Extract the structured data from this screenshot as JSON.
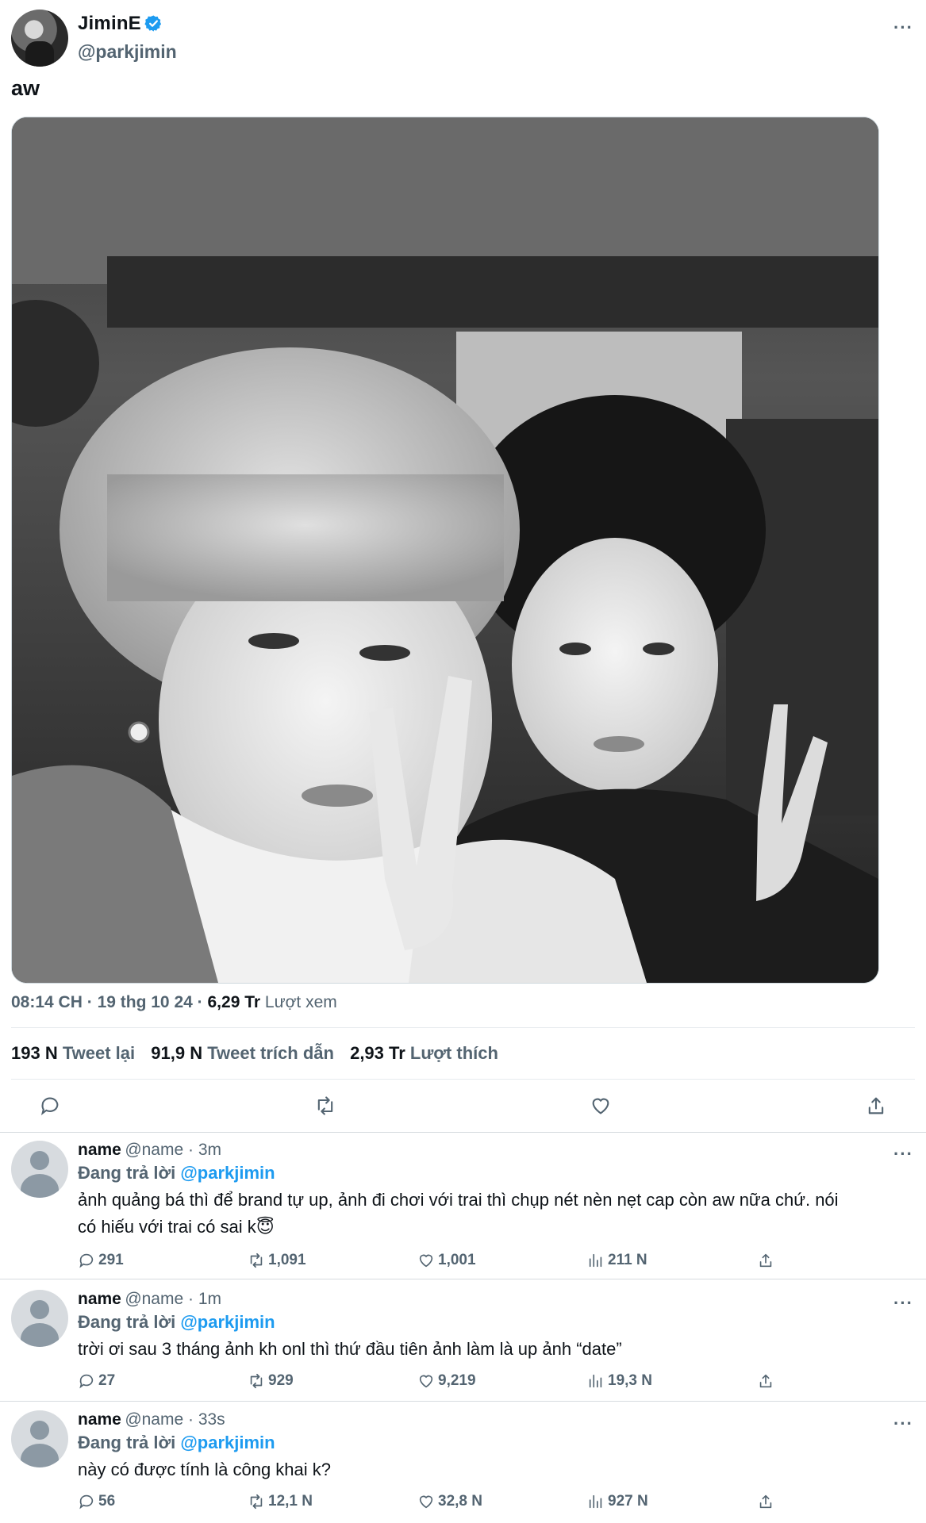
{
  "tweet": {
    "author_name": "JiminE",
    "author_handle": "@parkjimin",
    "text": "aw",
    "time": "08:14 CH",
    "date": "19 thg 10 24",
    "views": "6,29 Tr",
    "views_label": "Lượt xem",
    "retweets": "193 N",
    "retweets_label": "Tweet lại",
    "quotes": "91,9 N",
    "quotes_label": "Tweet trích dẫn",
    "likes": "2,93 Tr",
    "likes_label": "Lượt thích",
    "more_label": "···",
    "dot": "·"
  },
  "replies": [
    {
      "name": "name",
      "handle": "@name · 3m",
      "replying_prefix": "Đang trả lời",
      "replying_to": "@parkjimin",
      "text_line1": "ảnh quảng bá thì để brand tự up, ảnh đi chơi với trai thì chụp nét nèn nẹt cap còn aw nữa chứ. nói",
      "text_line2": "có hiếu với trai có sai k😇",
      "replies": "291",
      "retweets": "1,091",
      "likes": "1,001",
      "views": "211 N"
    },
    {
      "name": "name",
      "handle": "@name · 1m",
      "replying_prefix": "Đang trả lời",
      "replying_to": "@parkjimin",
      "text_line1": "trời ơi sau 3 tháng ảnh kh onl thì thứ đầu tiên ảnh làm là up ảnh “date”",
      "text_line2": "",
      "replies": "27",
      "retweets": "929",
      "likes": "9,219",
      "views": "19,3 N"
    },
    {
      "name": "name",
      "handle": "@name · 33s",
      "replying_prefix": "Đang trả lời",
      "replying_to": "@parkjimin",
      "text_line1": "này có được tính là công khai k?",
      "text_line2": "",
      "replies": "56",
      "retweets": "12,1 N",
      "likes": "32,8 N",
      "views": "927 N"
    }
  ],
  "colors": {
    "accent": "#1d9bf0",
    "muted": "#536471",
    "divider": "#e7ebee"
  },
  "icons": [
    "verified-badge-icon",
    "more-icon",
    "reply-icon",
    "retweet-icon",
    "like-icon",
    "share-icon",
    "views-icon"
  ]
}
